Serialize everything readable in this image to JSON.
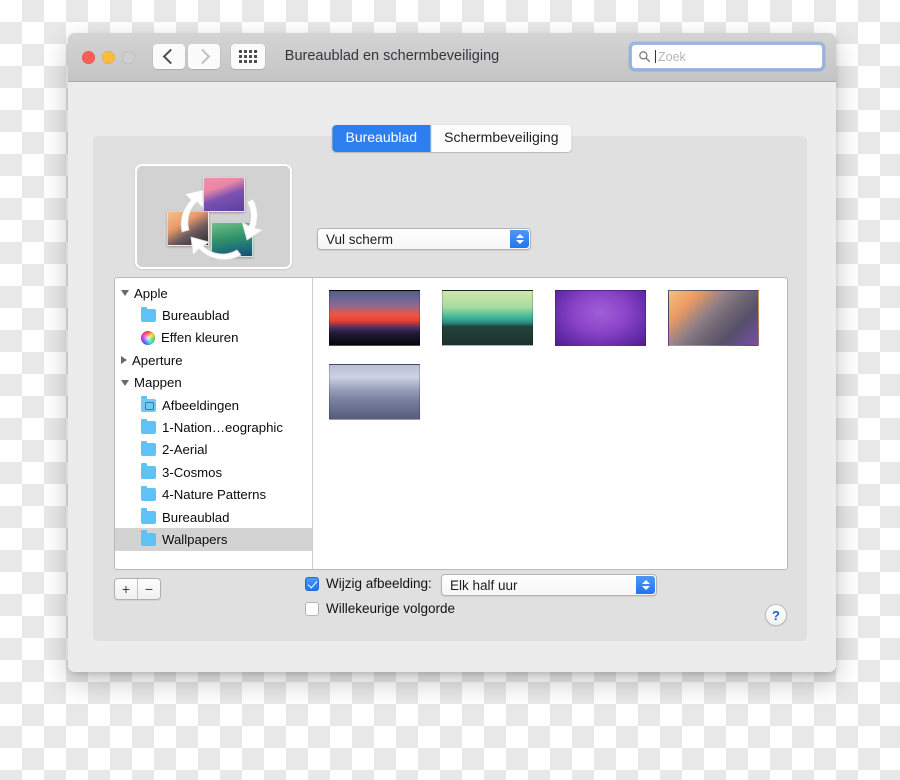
{
  "window": {
    "title": "Bureaublad en schermbeveiliging",
    "traffic_lights": [
      "close",
      "minimize",
      "zoom"
    ],
    "nav": {
      "back": "back-chevron",
      "forward": "forward-chevron",
      "grid": "show-all-grid"
    }
  },
  "search": {
    "placeholder": "Zoek",
    "value": "",
    "icon": "search-icon"
  },
  "tabs": [
    {
      "label": "Bureaublad",
      "active": true
    },
    {
      "label": "Schermbeveiliging",
      "active": false
    }
  ],
  "preview": {
    "name": "desktop-preview",
    "thumbnails": [
      {
        "name": "preview-thumb-top",
        "colors": [
          "#ef8fa6",
          "#5b3fa0"
        ]
      },
      {
        "name": "preview-thumb-left",
        "colors": [
          "#f5c08a",
          "#2b2b33"
        ]
      },
      {
        "name": "preview-thumb-right",
        "colors": [
          "#6fbf88",
          "#184f6e"
        ]
      }
    ],
    "arrow_color": "#ffffff"
  },
  "fit_popup": {
    "value": "Vul scherm",
    "icon": "stepper-chevrons-icon"
  },
  "sidebar": {
    "items": [
      {
        "label": "Apple",
        "icon": "disclosure-open",
        "indent": 0,
        "selected": false
      },
      {
        "label": "Bureaublad",
        "icon": "folder-icon",
        "indent": 1,
        "selected": false
      },
      {
        "label": "Effen kleuren",
        "icon": "color-wheel-icon",
        "indent": 1,
        "selected": false
      },
      {
        "label": "Aperture",
        "icon": "disclosure-closed",
        "indent": 0,
        "selected": false
      },
      {
        "label": "Mappen",
        "icon": "disclosure-open",
        "indent": 0,
        "selected": false
      },
      {
        "label": "Afbeeldingen",
        "icon": "pictures-folder-icon",
        "indent": 1,
        "selected": false
      },
      {
        "label": "1-Nation…eographic",
        "icon": "folder-icon",
        "indent": 1,
        "selected": false
      },
      {
        "label": "2-Aerial",
        "icon": "folder-icon",
        "indent": 1,
        "selected": false
      },
      {
        "label": "3-Cosmos",
        "icon": "folder-icon",
        "indent": 1,
        "selected": false
      },
      {
        "label": "4-Nature Patterns",
        "icon": "folder-icon",
        "indent": 1,
        "selected": false
      },
      {
        "label": "Bureaublad",
        "icon": "folder-icon",
        "indent": 1,
        "selected": false
      },
      {
        "label": "Wallpapers",
        "icon": "folder-icon",
        "indent": 1,
        "selected": true
      }
    ]
  },
  "wallpapers": [
    {
      "name": "wallpaper-sunset-ridge",
      "css": "linear-gradient(to bottom,#4f5f91 0%,#8a6a92 26%,#f0553f 45%,#e8422e 55%,#4b2f63 68%,#221a3a 78%,#060608 100%)"
    },
    {
      "name": "wallpaper-green-mountains",
      "css": "linear-gradient(to bottom,#cfe8a8 0%,#a8dba0 30%,#3fb89a 48%,#2b8f83 58%,#24413c 66%,#1d322c 100%)"
    },
    {
      "name": "wallpaper-purple-gradient",
      "css": "radial-gradient(ellipse at 50% 40%,#a05fd8 0%,#8a45c8 42%,#6a2fae 72%,#4f1f8f 100%)"
    },
    {
      "name": "wallpaper-yosemite",
      "css": "linear-gradient(135deg,#f7c07a 0%,#eb9a62 22%,#8f7f86 42%,#6d6572 58%,#54506a 74%,#7b4fa8 100%)"
    },
    {
      "name": "wallpaper-snow-peaks",
      "css": "linear-gradient(to bottom,#b9bfd4 0%,#cdd2e2 22%,#9aa0bb 45%,#7d83a3 62%,#6a7090 80%,#565c7c 100%)"
    }
  ],
  "add_remove": {
    "add": "+",
    "remove": "−"
  },
  "options": {
    "change_image": {
      "label": "Wijzig afbeelding:",
      "checked": true
    },
    "interval": {
      "value": "Elk half uur",
      "icon": "stepper-chevrons-icon"
    },
    "random_order": {
      "label": "Willekeurige volgorde",
      "checked": false
    }
  },
  "help": {
    "label": "?",
    "color": "#1763d6"
  }
}
